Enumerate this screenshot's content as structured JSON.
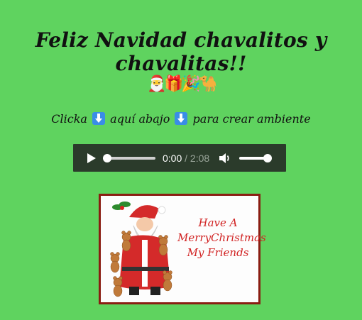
{
  "title": "Feliz Navidad chavalitos y chavalitas!!",
  "emojis": [
    "🎅",
    "🎁",
    "🎉",
    "🐪"
  ],
  "instruction": {
    "before": "Clicka",
    "middle": "aquí abajo",
    "after": "para crear ambiente",
    "icon": "down-arrow-icon"
  },
  "audio_player": {
    "current_time": "0:00",
    "duration": "/ 2:08",
    "progress": 0.0,
    "volume": 1.0
  },
  "greeting_card": {
    "line1": "Have A",
    "line2": "MerryChristmas",
    "line3": "My Friends"
  },
  "colors": {
    "background": "#5fd35f",
    "player": "#2b3b2b",
    "card_border": "#8a1d12",
    "card_text": "#d12222"
  }
}
